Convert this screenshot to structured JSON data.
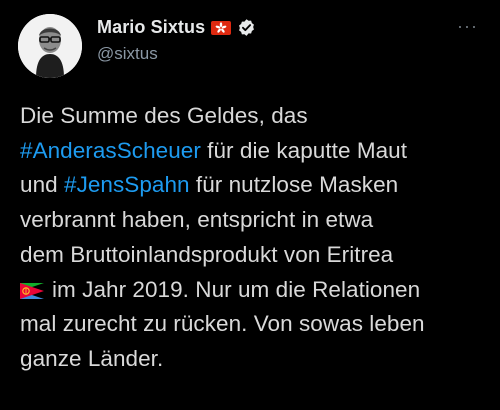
{
  "author": {
    "display_name": "Mario Sixtus",
    "handle": "@sixtus",
    "name_flag_icon": "hong-kong-flag-icon",
    "verified_icon": "verified-badge-icon"
  },
  "more_menu": {
    "label": "···"
  },
  "tweet": {
    "line1": "Die Summe des Geldes, das",
    "hashtag1": "#AnderasScheuer",
    "line2_rest": " für die kaputte Maut",
    "line3_start": "und ",
    "hashtag2": "#JensSpahn",
    "line3_rest": " für nutzlose Masken",
    "line4": "verbrannt haben, entspricht in etwa",
    "line5": "dem Bruttoinlandsprodukt von Eritrea",
    "inline_flag_icon": "eritrea-flag-icon",
    "line6_rest": "im Jahr 2019. Nur um die Relationen",
    "line7": "mal zurecht zu rücken. Von sowas leben",
    "line8": "ganze Länder."
  },
  "colors": {
    "background": "#000000",
    "text": "#d9d9d9",
    "hashtag": "#1d9bf0",
    "secondary": "#8b98a5"
  }
}
